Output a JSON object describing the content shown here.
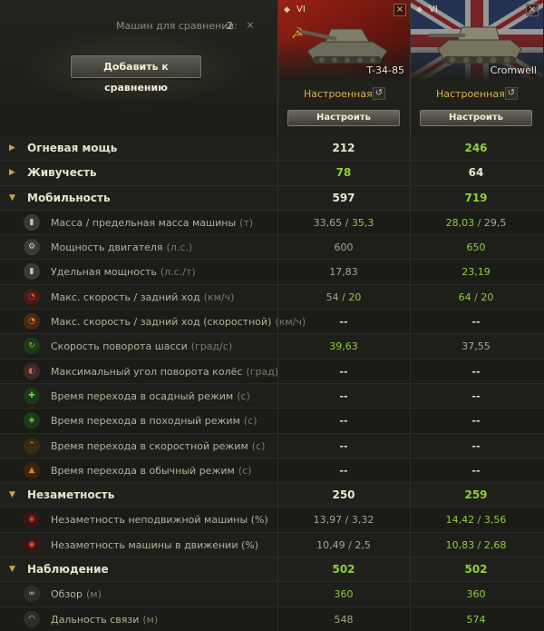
{
  "header": {
    "compare_label": "Машин для сравнения:",
    "compare_count": "2",
    "close_glyph": "×",
    "add_button": "Добавить к сравнению"
  },
  "vehicles": [
    {
      "tier": "VI",
      "name": "T-34-85",
      "nation": "USSR",
      "flag_color": "#8a1b12",
      "status": "Настроенная",
      "setup_button": "Настроить",
      "close_glyph": "×",
      "reset_glyph": "↺",
      "class_glyph": "◆"
    },
    {
      "tier": "VI",
      "name": "Cromwell",
      "nation": "UK",
      "flag_color": "#2a3c6e",
      "status": "Настроенная",
      "setup_button": "Настроить",
      "close_glyph": "×",
      "reset_glyph": "↺",
      "class_glyph": "◆"
    }
  ],
  "rows": [
    {
      "type": "cat",
      "expanded": false,
      "label": "Огневая мощь",
      "v1": "212",
      "c1": "white",
      "v2": "246",
      "c2": "green"
    },
    {
      "type": "cat",
      "expanded": false,
      "label": "Живучесть",
      "v1": "78",
      "c1": "green",
      "v2": "64",
      "c2": "white"
    },
    {
      "type": "cat",
      "expanded": true,
      "label": "Мобильность",
      "v1": "597",
      "c1": "white",
      "v2": "719",
      "c2": "green"
    },
    {
      "type": "sub",
      "icon": "weight-icon",
      "icon_glyph": "▮",
      "label": "Масса / предельная масса машины",
      "unit": "(т)",
      "v1a": "33,65",
      "c1a": "gray",
      "v1b": "35,3",
      "c1b": "green",
      "v2a": "28,03",
      "c2a": "green",
      "v2b": "29,5",
      "c2b": "gray"
    },
    {
      "type": "sub",
      "icon": "engine-icon",
      "icon_glyph": "⚙",
      "label": "Мощность двигателя",
      "unit": "(л.с.)",
      "v1": "600",
      "c1": "gray",
      "v2": "650",
      "c2": "green"
    },
    {
      "type": "sub",
      "icon": "specific-power-icon",
      "icon_glyph": "▮",
      "label": "Удельная мощность",
      "unit": "(л.с./т)",
      "v1": "17,83",
      "c1": "gray",
      "v2": "23,19",
      "c2": "green"
    },
    {
      "type": "sub",
      "icon": "speed-icon",
      "icon_glyph": "◔",
      "label": "Макс. скорость / задний ход",
      "unit": "(км/ч)",
      "v1a": "54",
      "c1a": "gray",
      "v1b": "20",
      "c1b": "green",
      "v2a": "64",
      "c2a": "green",
      "v2b": "20",
      "c2b": "green"
    },
    {
      "type": "sub",
      "icon": "speed-fast-icon",
      "icon_glyph": "◔",
      "label": "Макс. скорость / задний ход (скоростной)",
      "unit": "(км/ч)",
      "v1": "--",
      "c1": "dash",
      "v2": "--",
      "c2": "dash"
    },
    {
      "type": "sub",
      "icon": "traverse-icon",
      "icon_glyph": "↻",
      "label": "Скорость поворота шасси",
      "unit": "(град/с)",
      "v1": "39,63",
      "c1": "green",
      "v2": "37,55",
      "c2": "gray"
    },
    {
      "type": "sub",
      "icon": "wheel-angle-icon",
      "icon_glyph": "◐",
      "label": "Максимальный угол поворота колёс",
      "unit": "(град)",
      "v1": "--",
      "c1": "dash",
      "v2": "--",
      "c2": "dash"
    },
    {
      "type": "sub",
      "icon": "siege-mode-icon",
      "icon_glyph": "✚",
      "label": "Время перехода в осадный режим",
      "unit": "(с)",
      "v1": "--",
      "c1": "dash",
      "v2": "--",
      "c2": "dash"
    },
    {
      "type": "sub",
      "icon": "travel-mode-icon",
      "icon_glyph": "◈",
      "label": "Время перехода в походный режим",
      "unit": "(с)",
      "v1": "--",
      "c1": "dash",
      "v2": "--",
      "c2": "dash"
    },
    {
      "type": "sub",
      "icon": "fast-mode-icon",
      "icon_glyph": "⌃",
      "label": "Время перехода в скоростной режим",
      "unit": "(с)",
      "v1": "--",
      "c1": "dash",
      "v2": "--",
      "c2": "dash"
    },
    {
      "type": "sub",
      "icon": "normal-mode-icon",
      "icon_glyph": "▲",
      "label": "Время перехода в обычный режим",
      "unit": "(с)",
      "v1": "--",
      "c1": "dash",
      "v2": "--",
      "c2": "dash"
    },
    {
      "type": "cat",
      "expanded": true,
      "label": "Незаметность",
      "v1": "250",
      "c1": "white",
      "v2": "259",
      "c2": "green"
    },
    {
      "type": "sub",
      "icon": "camo-stationary-icon",
      "icon_glyph": "◉",
      "label": "Незаметность неподвижной машины (%)",
      "unit": "",
      "v1a": "13,97",
      "c1a": "gray",
      "v1b": "3,32",
      "c1b": "gray",
      "v2a": "14,42",
      "c2a": "green",
      "v2b": "3,56",
      "c2b": "green"
    },
    {
      "type": "sub",
      "icon": "camo-moving-icon",
      "icon_glyph": "◉",
      "label": "Незаметность машины в движении (%)",
      "unit": "",
      "v1a": "10,49",
      "c1a": "gray",
      "v1b": "2,5",
      "c1b": "gray",
      "v2a": "10,83",
      "c2a": "green",
      "v2b": "2,68",
      "c2b": "green"
    },
    {
      "type": "cat",
      "expanded": true,
      "label": "Наблюдение",
      "v1": "502",
      "c1": "green",
      "v2": "502",
      "c2": "green"
    },
    {
      "type": "sub",
      "icon": "binoculars-icon",
      "icon_glyph": "∞",
      "label": "Обзор",
      "unit": "(м)",
      "v1": "360",
      "c1": "green",
      "v2": "360",
      "c2": "green"
    },
    {
      "type": "sub",
      "icon": "radio-icon",
      "icon_glyph": "◠",
      "label": "Дальность связи",
      "unit": "(м)",
      "v1": "548",
      "c1": "gray",
      "v2": "574",
      "c2": "green"
    }
  ]
}
